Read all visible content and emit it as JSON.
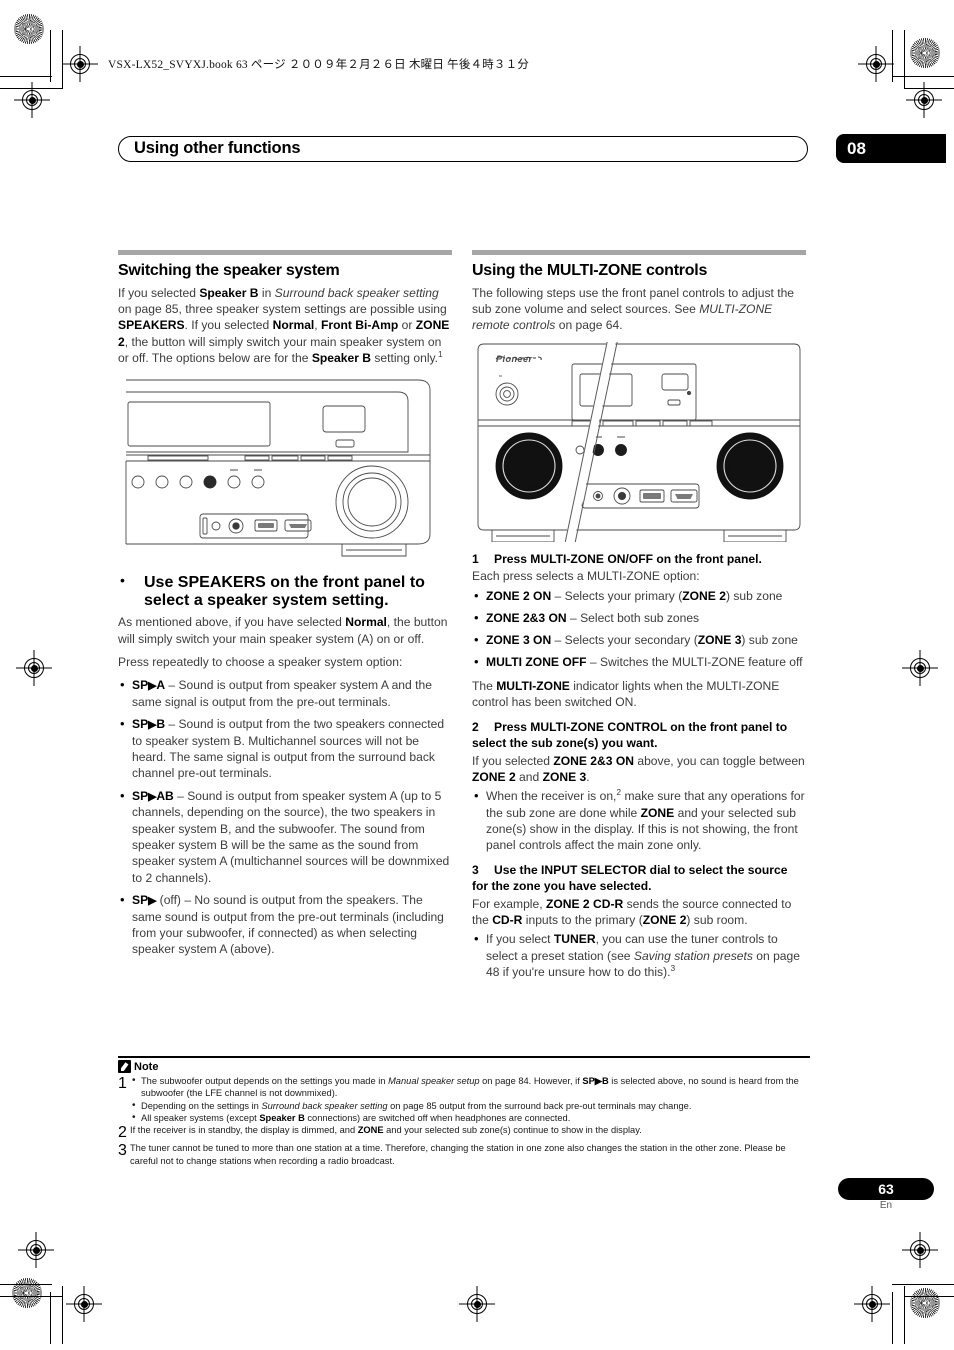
{
  "print": {
    "book_line": "VSX-LX52_SVYXJ.book   63 ページ   ２００９年２月２６日   木曜日   午後４時３１分"
  },
  "chapter": {
    "title": "Using other functions",
    "number": "08"
  },
  "left_column": {
    "heading": "Switching the speaker system",
    "intro_parts": {
      "p1_a": "If you selected ",
      "p1_b_speakerB": "Speaker B",
      "p1_c": " in ",
      "p1_i_surround": "Surround back speaker setting",
      "p1_d": " on page 85, three speaker system settings are possible using ",
      "p1_b_speakers": "SPEAKERS",
      "p1_e": ". If you selected ",
      "p1_b_normal": "Normal",
      "p1_f": ", ",
      "p1_b_frontbiamp": "Front Bi-Amp",
      "p1_g": " or ",
      "p1_b_zone2": "ZONE 2",
      "p1_h": ", the button will simply switch your main speaker system on or off. The options below are for the ",
      "p1_b_speakerB2": "Speaker B",
      "p1_i2": " setting only.",
      "p1_sup": "1"
    },
    "figure_caption": "",
    "instruction_bullet": {
      "bold_a": "Use SPEAKERS on the front panel to select a speaker system setting.",
      "body_a": "As mentioned above, if you have selected ",
      "body_b_normal": "Normal",
      "body_c": ", the button will simply switch your main speaker system (A) on or off."
    },
    "press_line": "Press repeatedly to choose a speaker system option:",
    "options": [
      {
        "label": "SP",
        "arrow": "▶",
        "label2": "A",
        "text": " – Sound is output from speaker system A and the same signal is output from the pre-out terminals."
      },
      {
        "label": "SP",
        "arrow": "▶",
        "label2": "B",
        "text": " – Sound is output from the two speakers connected to speaker system B. Multichannel sources will not be heard. The same signal is output from the surround back channel pre-out terminals."
      },
      {
        "label": "SP",
        "arrow": "▶",
        "label2": "AB",
        "text": " – Sound is output from speaker system A (up to 5 channels, depending on the source), the two speakers in speaker system B, and the subwoofer. The sound from speaker system B will be the same as the sound from speaker system A (multichannel sources will be downmixed to 2 channels)."
      },
      {
        "label": "SP",
        "arrow": "▶",
        "label2": "",
        "text": " (off) – No sound is output from the speakers. The same sound is output from the pre-out terminals (including from your subwoofer, if connected) as when selecting speaker system A (above)."
      }
    ]
  },
  "right_column": {
    "heading": "Using the MULTI-ZONE controls",
    "intro_a": "The following steps use the front panel controls to adjust the sub zone volume and select sources. See ",
    "intro_i": "MULTI-ZONE remote controls",
    "intro_b": " on page 64.",
    "brand": "Pioneer",
    "step1": {
      "num": "1",
      "title": "Press MULTI-ZONE ON/OFF on the front panel.",
      "body": "Each press selects a MULTI-ZONE option:",
      "options": [
        {
          "bold": "ZONE 2 ON",
          "text_a": " – Selects your primary (",
          "bold2": "ZONE 2",
          "text_b": ") sub zone"
        },
        {
          "bold": "ZONE 2&3 ON",
          "text_a": " – Select both sub zones",
          "bold2": "",
          "text_b": ""
        },
        {
          "bold": "ZONE 3 ON",
          "text_a": " – Selects your secondary (",
          "bold2": "ZONE 3",
          "text_b": ") sub zone"
        },
        {
          "bold": "MULTI ZONE OFF",
          "text_a": " – Switches the MULTI-ZONE feature off",
          "bold2": "",
          "text_b": ""
        }
      ],
      "after_a": "The ",
      "after_bold": "MULTI-ZONE",
      "after_b": " indicator lights when the MULTI-ZONE control has been switched ON."
    },
    "step2": {
      "num": "2",
      "title": "Press MULTI-ZONE CONTROL on the front panel to select the sub zone(s) you want.",
      "body_a": "If you selected ",
      "body_bold": "ZONE 2&3 ON",
      "body_b": " above, you can toggle between ",
      "body_bold2": "ZONE 2",
      "body_c": " and ",
      "body_bold3": "ZONE 3",
      "body_d": ".",
      "bullet_a": "When the receiver is on,",
      "bullet_sup": "2",
      "bullet_b": " make sure that any operations for the sub zone are done while ",
      "bullet_bold": "ZONE",
      "bullet_c": " and your selected sub zone(s) show in the display. If this is not showing, the front panel controls affect the main zone only."
    },
    "step3": {
      "num": "3",
      "title": "Use the INPUT SELECTOR dial to select the source for the zone you have selected.",
      "body_a": "For example, ",
      "body_bold": "ZONE 2 CD-R",
      "body_b": " sends the source connected to the ",
      "body_bold2": "CD-R",
      "body_c": " inputs to the primary (",
      "body_bold3": "ZONE 2",
      "body_d": ") sub room.",
      "bullet_a": "If you select ",
      "bullet_bold": "TUNER",
      "bullet_b": ", you can use the tuner controls to select a preset station (see ",
      "bullet_i": "Saving station presets",
      "bullet_c": " on page 48 if you're unsure how to do this).",
      "bullet_sup": "3"
    }
  },
  "notes": {
    "label": "Note",
    "items": [
      {
        "num": "1",
        "lines": [
          {
            "a": "The subwoofer output depends on the settings you made in ",
            "i": "Manual speaker setup",
            "b": " on page 84. However, if ",
            "bold": "SP▶B",
            "c": " is selected above, no sound is heard from the subwoofer (the LFE channel is not downmixed)."
          },
          {
            "a": "Depending on the settings in ",
            "i": "Surround back speaker setting",
            "b": " on page 85 output from the surround back pre-out terminals may change.",
            "bold": "",
            "c": ""
          },
          {
            "a": "All speaker systems (except ",
            "i": "",
            "b": "",
            "bold": "Speaker B",
            "c": " connections) are switched off when headphones are connected."
          }
        ]
      },
      {
        "num": "2",
        "text_a": "If the receiver is in standby, the display is dimmed, and ",
        "text_bold": "ZONE",
        "text_b": " and your selected sub zone(s) continue to show in the display."
      },
      {
        "num": "3",
        "text_a": "The tuner cannot be tuned to more than one station at a time. Therefore, changing the station in one zone also changes the station in the other zone. Please be careful not to change stations when recording a radio broadcast.",
        "text_bold": "",
        "text_b": ""
      }
    ]
  },
  "footer": {
    "page_number": "63",
    "language": "En"
  }
}
